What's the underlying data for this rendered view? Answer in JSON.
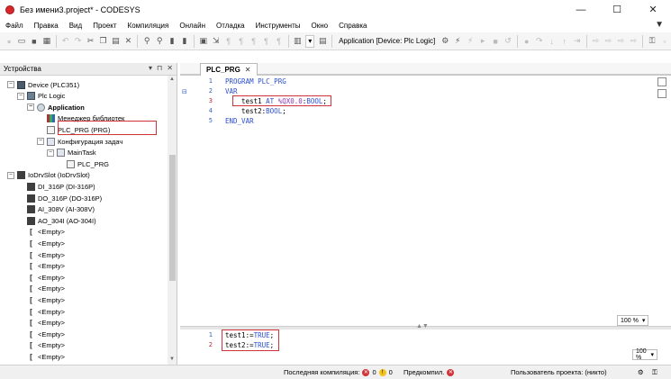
{
  "window": {
    "title": "Без имени3.project* - CODESYS",
    "minimize": "—",
    "maximize": "☐",
    "close": "✕"
  },
  "menu": [
    "Файл",
    "Правка",
    "Вид",
    "Проект",
    "Компиляция",
    "Онлайн",
    "Отладка",
    "Инструменты",
    "Окно",
    "Справка"
  ],
  "toolbar": {
    "application_selector": "Application [Device: Plc Logic]",
    "combo_value": ""
  },
  "devices_panel": {
    "title": "Устройства",
    "pin": "▾",
    "dock": "⊓",
    "close": "✕",
    "tree": [
      {
        "label": "Device (PLC351)",
        "icon": "device-icon",
        "depth": 0,
        "expand": "−",
        "bold": false
      },
      {
        "label": "Plc Logic",
        "icon": "plc-logic-icon",
        "depth": 1,
        "expand": "−",
        "bold": false
      },
      {
        "label": "Application",
        "icon": "application-icon",
        "depth": 2,
        "expand": "−",
        "bold": true
      },
      {
        "label": "Менеджер библиотек",
        "icon": "library-manager-icon",
        "depth": 3,
        "expand": "",
        "bold": false
      },
      {
        "label": "PLC_PRG (PRG)",
        "icon": "program-icon",
        "depth": 3,
        "expand": "",
        "bold": false
      },
      {
        "label": "Конфигурация задач",
        "icon": "task-config-icon",
        "depth": 3,
        "expand": "−",
        "bold": false
      },
      {
        "label": "MainTask",
        "icon": "task-icon",
        "depth": 4,
        "expand": "−",
        "bold": false
      },
      {
        "label": "PLC_PRG",
        "icon": "program-call-icon",
        "depth": 5,
        "expand": "",
        "bold": false
      },
      {
        "label": "IoDrvSlot (IoDrvSlot)",
        "icon": "slot-icon",
        "depth": 0,
        "expand": "−",
        "bold": false
      },
      {
        "label": "DI_316P (DI-316P)",
        "icon": "module-icon",
        "depth": 1,
        "expand": "",
        "bold": false
      },
      {
        "label": "DO_316P (DO-316P)",
        "icon": "module-icon",
        "depth": 1,
        "expand": "",
        "bold": false
      },
      {
        "label": "AI_308V (AI-308V)",
        "icon": "module-icon",
        "depth": 1,
        "expand": "",
        "bold": false
      },
      {
        "label": "AO_304I (AO-304I)",
        "icon": "module-icon",
        "depth": 1,
        "expand": "",
        "bold": false
      },
      {
        "label": "<Empty>",
        "icon": "empty-slot-icon",
        "depth": 1,
        "expand": "",
        "bold": false
      },
      {
        "label": "<Empty>",
        "icon": "empty-slot-icon",
        "depth": 1,
        "expand": "",
        "bold": false
      },
      {
        "label": "<Empty>",
        "icon": "empty-slot-icon",
        "depth": 1,
        "expand": "",
        "bold": false
      },
      {
        "label": "<Empty>",
        "icon": "empty-slot-icon",
        "depth": 1,
        "expand": "",
        "bold": false
      },
      {
        "label": "<Empty>",
        "icon": "empty-slot-icon",
        "depth": 1,
        "expand": "",
        "bold": false
      },
      {
        "label": "<Empty>",
        "icon": "empty-slot-icon",
        "depth": 1,
        "expand": "",
        "bold": false
      },
      {
        "label": "<Empty>",
        "icon": "empty-slot-icon",
        "depth": 1,
        "expand": "",
        "bold": false
      },
      {
        "label": "<Empty>",
        "icon": "empty-slot-icon",
        "depth": 1,
        "expand": "",
        "bold": false
      },
      {
        "label": "<Empty>",
        "icon": "empty-slot-icon",
        "depth": 1,
        "expand": "",
        "bold": false
      },
      {
        "label": "<Empty>",
        "icon": "empty-slot-icon",
        "depth": 1,
        "expand": "",
        "bold": false
      },
      {
        "label": "<Empty>",
        "icon": "empty-slot-icon",
        "depth": 1,
        "expand": "",
        "bold": false
      },
      {
        "label": "<Empty>",
        "icon": "empty-slot-icon",
        "depth": 1,
        "expand": "",
        "bold": false
      },
      {
        "label": "<Empty>",
        "icon": "empty-slot-icon",
        "depth": 1,
        "expand": "",
        "bold": false
      }
    ]
  },
  "editor": {
    "tab_label": "PLC_PRG",
    "tab_close": "✕",
    "declaration": [
      {
        "n": "1",
        "text": "PROGRAM PLC_PRG"
      },
      {
        "n": "2",
        "text": "VAR"
      },
      {
        "n": "3",
        "text": "    test1 AT %QX0.0:BOOL;"
      },
      {
        "n": "4",
        "text": "    test2:BOOL;"
      },
      {
        "n": "5",
        "text": "END_VAR"
      }
    ],
    "implementation": [
      {
        "n": "1",
        "text": "test1:=TRUE;"
      },
      {
        "n": "2",
        "text": "test2:=TRUE;"
      }
    ],
    "zoom_decl": "100 %",
    "zoom_impl": "100 %"
  },
  "status": {
    "last_compile_label": "Последняя компиляция:",
    "errors": "0",
    "warnings": "0",
    "precompile_label": "Предкомпил.",
    "project_user": "Пользователь проекта: (никто)"
  },
  "colors": {
    "keyword": "#2b4fd1",
    "address": "#8f3ab5",
    "highlight": "#d0343a",
    "line_number": "#3a64c8"
  }
}
